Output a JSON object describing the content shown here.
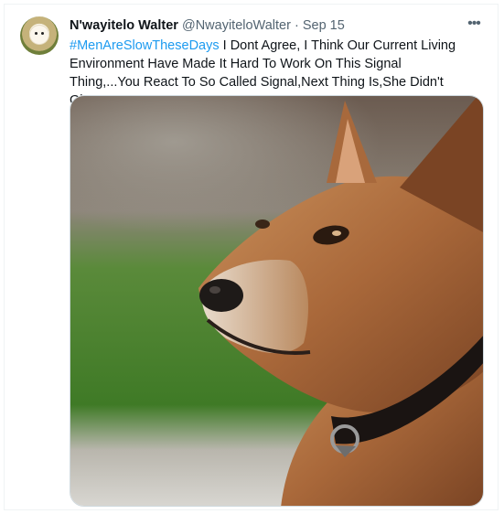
{
  "tweet": {
    "author_name": "N'wayitelo Walter",
    "author_handle": "@NwayiteloWalter",
    "separator": "·",
    "timestamp": "Sep 15",
    "more_icon": "ellipsis-icon",
    "more_label": "•••",
    "hashtag": "#MenAreSlowTheseDays",
    "body": " I Dont Agree, I Think Our Current Living Environment Have Made It Hard To Work On This Signal Thing,...You React To So Called Signal,Next Thing Is,She Didn't Give Consent",
    "avatar_icon": "puppy-avatar"
  },
  "media": {
    "subject": "dog-photo"
  },
  "colors": {
    "link": "#1d9bf0",
    "secondary_text": "#536471",
    "primary_text": "#0f1419",
    "border": "#cfd9de"
  }
}
